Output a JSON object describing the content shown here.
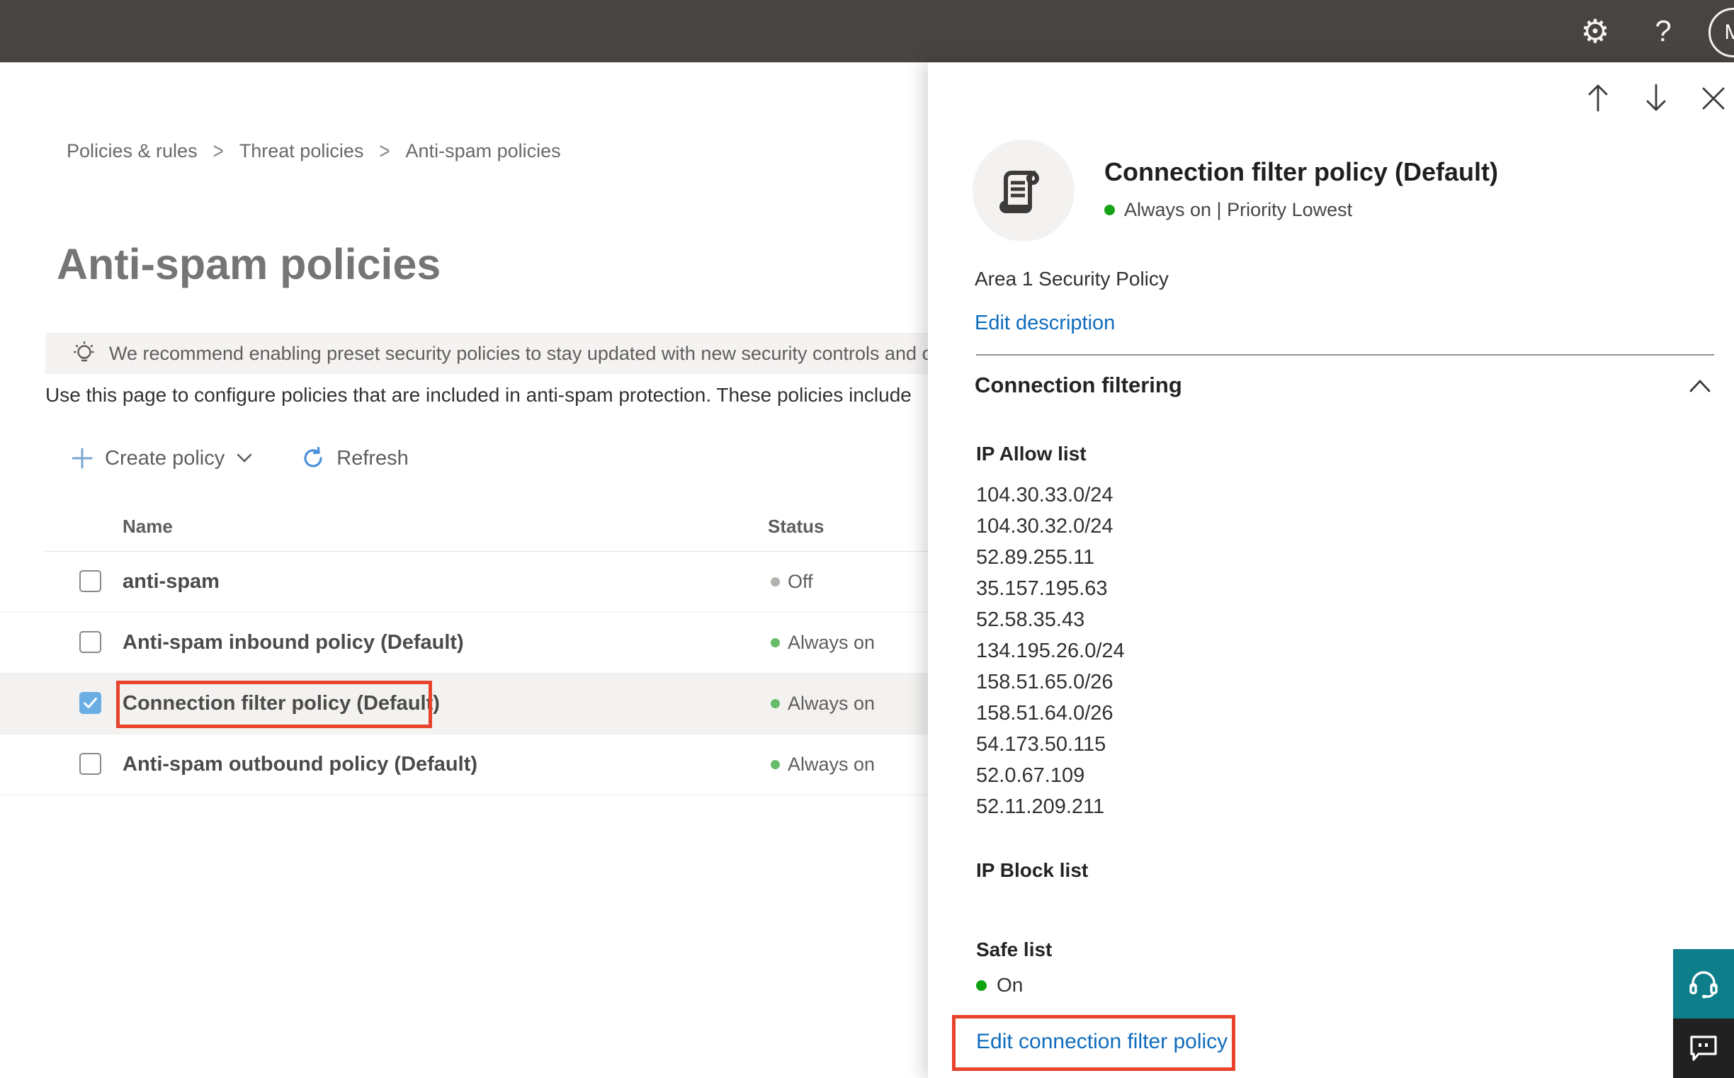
{
  "topbar": {
    "avatar_initial": "M",
    "icons": {
      "settings": "⚙",
      "help": "?"
    }
  },
  "breadcrumb": {
    "separator": ">",
    "items": [
      {
        "label": "Policies & rules"
      },
      {
        "label": "Threat policies"
      },
      {
        "label": "Anti-spam policies"
      }
    ]
  },
  "page": {
    "title": "Anti-spam policies",
    "banner_text": "We recommend enabling preset security policies to stay updated with new security controls and our recomme",
    "description": "Use this page to configure policies that are included in anti-spam protection. These policies include"
  },
  "toolbar": {
    "create_label": "Create policy",
    "refresh_label": "Refresh"
  },
  "table": {
    "columns": {
      "name": "Name",
      "status": "Status"
    },
    "rows": [
      {
        "name": "anti-spam",
        "status": "Off",
        "checked": false
      },
      {
        "name": "Anti-spam inbound policy (Default)",
        "status": "Always on",
        "checked": false
      },
      {
        "name": "Connection filter policy (Default)",
        "status": "Always on",
        "checked": true
      },
      {
        "name": "Anti-spam outbound policy (Default)",
        "status": "Always on",
        "checked": false
      }
    ]
  },
  "flyout": {
    "title": "Connection filter policy (Default)",
    "status_line": "Always on | Priority Lowest",
    "description": "Area 1 Security Policy",
    "edit_description_label": "Edit description",
    "section_title": "Connection filtering",
    "ip_allow": {
      "label": "IP Allow list",
      "items": [
        "104.30.33.0/24",
        "104.30.32.0/24",
        "52.89.255.11",
        "35.157.195.63",
        "52.58.35.43",
        "134.195.26.0/24",
        "158.51.65.0/26",
        "158.51.64.0/26",
        "54.173.50.115",
        "52.0.67.109",
        "52.11.209.211"
      ]
    },
    "ip_block": {
      "label": "IP Block list"
    },
    "safe_list": {
      "label": "Safe list",
      "value": "On"
    },
    "edit_link_label": "Edit connection filter policy"
  },
  "colors": {
    "topbar_bg": "#474442",
    "link_blue": "#0f6cbd",
    "status_green": "#66bb6a",
    "flyout_status_green": "#15a415",
    "status_off_gray": "#b3b0ad",
    "checkbox_blue": "#6aaee3",
    "annotation_red": "#e8432d",
    "support_teal": "#0f7e8b",
    "feedback_dark": "#212121"
  }
}
